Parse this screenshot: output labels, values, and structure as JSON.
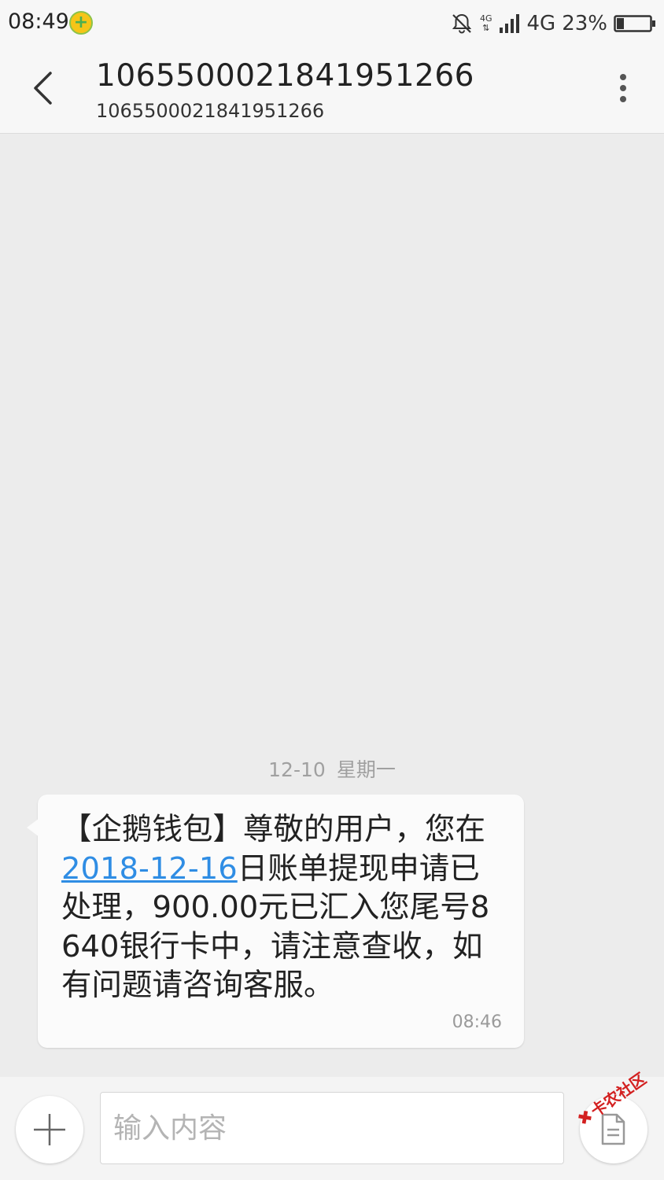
{
  "status_bar": {
    "time": "08:49",
    "network_small_top": "4G",
    "network_label": "4G",
    "battery_percent": "23%",
    "battery_level": 0.23,
    "icons": [
      "notification-app-icon",
      "bell-muted-icon",
      "signal-icon",
      "battery-icon"
    ]
  },
  "header": {
    "title": "1065500021841951266",
    "subtitle": "1065500021841951266",
    "icons": [
      "back-chevron-icon",
      "more-vert-icon"
    ]
  },
  "conversation": {
    "date": "12-10",
    "weekday": "星期一",
    "message": {
      "text_before": "【企鹅钱包】尊敬的用户，您在",
      "link_text": "2018-12-16",
      "text_after": "日账单提现申请已处理，900.00元已汇入您尾号8640银行卡中，请注意查收，如有问题请咨询客服。",
      "time": "08:46"
    }
  },
  "composer": {
    "placeholder": "输入内容",
    "value": "",
    "icons": [
      "plus-icon",
      "send-sms-icon"
    ]
  },
  "watermark": {
    "text": "卡农社区"
  },
  "colors": {
    "link": "#2f8de4",
    "background": "#ececec",
    "bubble": "#fbfbfb",
    "watermark": "#d32020"
  }
}
